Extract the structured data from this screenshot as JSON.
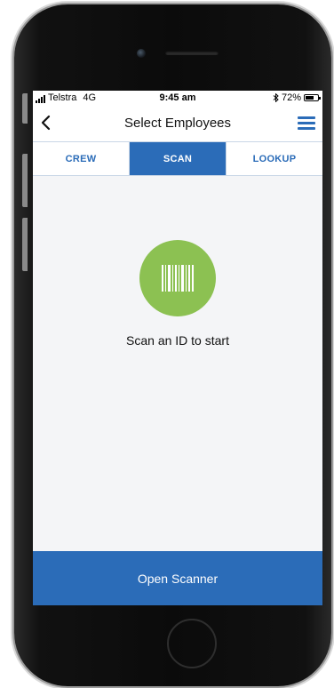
{
  "status_bar": {
    "carrier": "Telstra",
    "network": "4G",
    "time": "9:45 am",
    "battery_text": "72%",
    "battery_level": 0.72,
    "bluetooth_icon": "bluetooth-icon"
  },
  "nav": {
    "title": "Select Employees",
    "back_icon": "chevron-left-icon",
    "menu_icon": "hamburger-menu-icon"
  },
  "tabs": [
    {
      "label": "CREW",
      "active": false
    },
    {
      "label": "SCAN",
      "active": true
    },
    {
      "label": "LOOKUP",
      "active": false
    }
  ],
  "scan": {
    "icon": "barcode-icon",
    "prompt": "Scan an ID to start"
  },
  "action_button": {
    "label": "Open Scanner"
  },
  "colors": {
    "accent": "#2b6cb8",
    "scan_badge": "#8cc152",
    "screen_background": "#f4f5f7"
  }
}
